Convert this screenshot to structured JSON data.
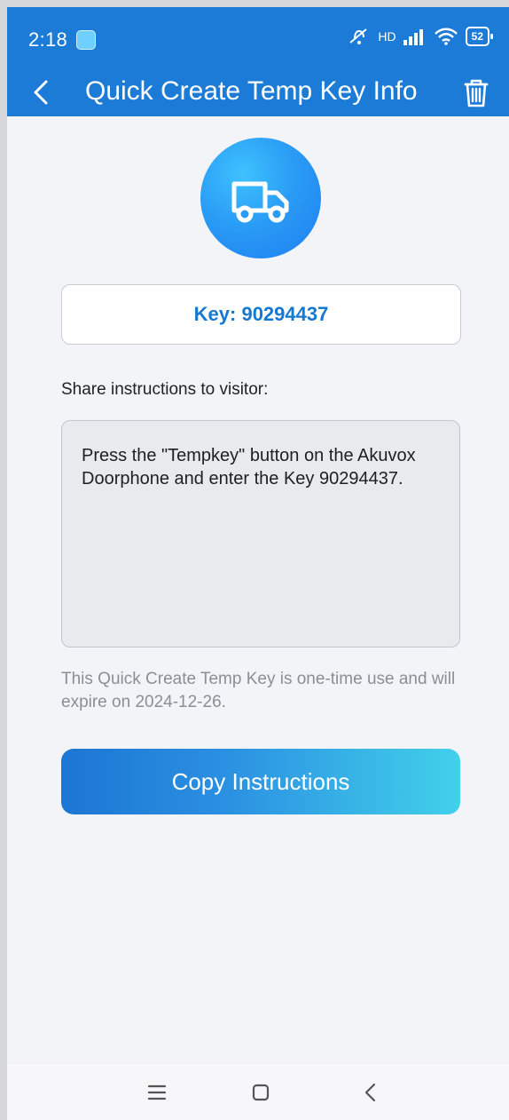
{
  "status_bar": {
    "time": "2:18",
    "network_badge": "HD",
    "battery": "52"
  },
  "header": {
    "title": "Quick Create Temp Key Info",
    "back_icon": "chevron-left-icon",
    "delete_icon": "trash-icon"
  },
  "main": {
    "avatar_icon": "truck-icon",
    "key_text": "Key: 90294437",
    "share_label": "Share instructions to visitor:",
    "instructions_text": "Press the \"Tempkey\" button on the Akuvox Doorphone and enter the Key 90294437.",
    "expiry_text": "This Quick Create Temp Key is one-time use and will expire on 2024-12-26.",
    "copy_button_label": "Copy Instructions"
  },
  "colors": {
    "accent": "#1b7bd6",
    "key_text": "#1578d2",
    "button_gradient_start": "#1c76d3",
    "button_gradient_end": "#42d0ea"
  },
  "nav": {
    "menu_icon": "menu-icon",
    "home_icon": "square-home-icon",
    "back_icon": "back-arrow-icon"
  }
}
